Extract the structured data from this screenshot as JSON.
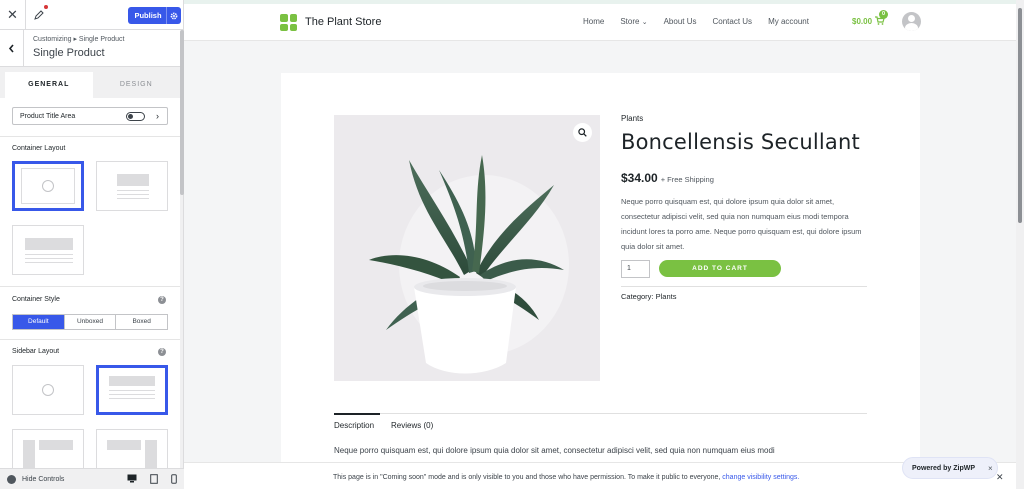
{
  "sidebar": {
    "publish_label": "Publish",
    "breadcrumb": "Customizing ▸ Single Product",
    "section_title": "Single Product",
    "tabs": [
      {
        "label": "GENERAL"
      },
      {
        "label": "DESIGN"
      }
    ],
    "product_title_area_label": "Product Title Area",
    "container_layout_label": "Container Layout",
    "container_style_label": "Container Style",
    "container_style_options": [
      "Default",
      "Unboxed",
      "Boxed"
    ],
    "container_style_selected": "Default",
    "sidebar_layout_label": "Sidebar Layout",
    "hide_controls_label": "Hide Controls",
    "accent_color": "#3858e9"
  },
  "site": {
    "title": "The Plant Store",
    "nav": [
      "Home",
      "Store",
      "About Us",
      "Contact Us",
      "My account"
    ],
    "cart_total": "$0.00",
    "cart_count": "0",
    "brand_color": "#7ac142"
  },
  "product": {
    "category": "Plants",
    "name": "Boncellensis Secullant",
    "price": "$34.00",
    "shipping": "+ Free Shipping",
    "description": "Neque porro quisquam est, qui dolore ipsum quia dolor sit amet, consectetur adipisci velit, sed quia non numquam eius modi tempora incidunt lores ta porro ame. Neque porro quisquam est, qui dolore ipsum quia dolor sit amet.",
    "quantity": "1",
    "add_to_cart": "ADD TO CART",
    "meta_label": "Category:",
    "meta_value": "Plants",
    "tabs": [
      "Description",
      "Reviews (0)"
    ],
    "long_description": "Neque porro quisquam est, qui dolore ipsum quia dolor sit amet, consectetur adipisci velit, sed quia non numquam eius modi"
  },
  "notice": {
    "text": "This page is in \"Coming soon\" mode and is only visible to you and those who have permission. To make it public to everyone,",
    "link": "change visibility settings."
  },
  "zipwp": {
    "label": "Powered by ZipWP",
    "close": "×"
  }
}
